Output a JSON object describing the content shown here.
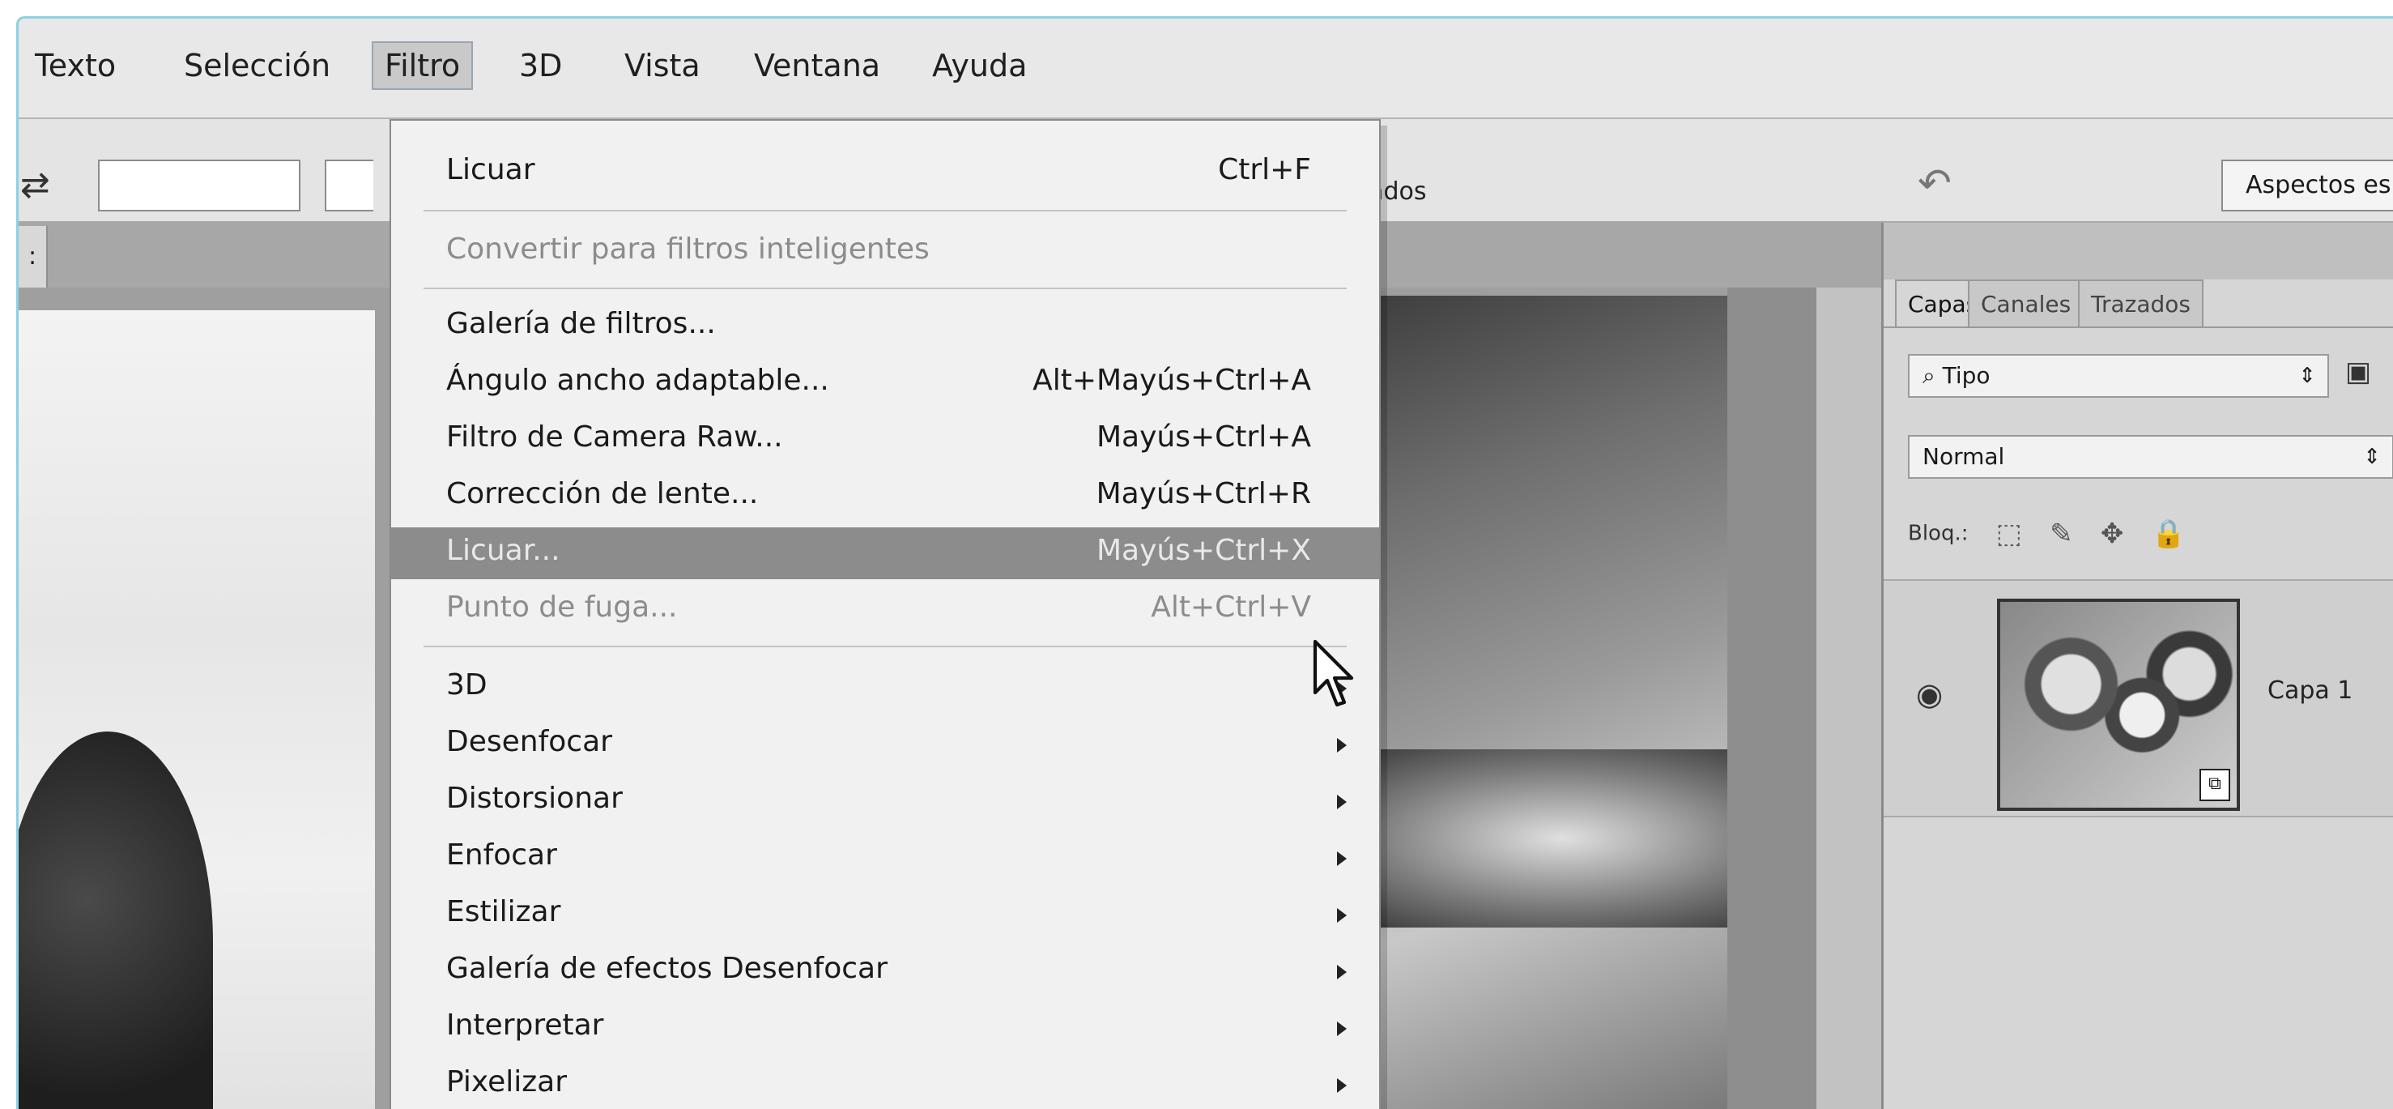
{
  "menubar": {
    "items": [
      {
        "label": "Texto"
      },
      {
        "label": "Selección"
      },
      {
        "label": "Filtro"
      },
      {
        "label": "3D"
      },
      {
        "label": "Vista"
      },
      {
        "label": "Ventana"
      },
      {
        "label": "Ayuda"
      }
    ],
    "active": "Filtro"
  },
  "options_bar": {
    "fragment_label": "recortados",
    "workspace_label": "Aspectos es",
    "icons": [
      "swap-arrows-icon",
      "undo-icon"
    ]
  },
  "document_tab": {
    "label": ":"
  },
  "filter_menu": {
    "last_filter": {
      "label": "Licuar",
      "shortcut": "Ctrl+F"
    },
    "convert_smart": {
      "label": "Convertir para filtros inteligentes"
    },
    "gallery": {
      "label": "Galería de filtros..."
    },
    "wide_angle": {
      "label": "Ángulo ancho adaptable...",
      "shortcut": "Alt+Mayús+Ctrl+A"
    },
    "camera_raw": {
      "label": "Filtro de Camera Raw...",
      "shortcut": "Mayús+Ctrl+A"
    },
    "lens": {
      "label": "Corrección de lente...",
      "shortcut": "Mayús+Ctrl+R"
    },
    "liquify": {
      "label": "Licuar...",
      "shortcut": "Mayús+Ctrl+X"
    },
    "vanishing": {
      "label": "Punto de fuga...",
      "shortcut": "Alt+Ctrl+V"
    },
    "submenus": [
      {
        "label": "3D"
      },
      {
        "label": "Desenfocar"
      },
      {
        "label": "Distorsionar"
      },
      {
        "label": "Enfocar"
      },
      {
        "label": "Estilizar"
      },
      {
        "label": "Galería de efectos Desenfocar"
      },
      {
        "label": "Interpretar"
      },
      {
        "label": "Pixelizar"
      }
    ]
  },
  "layers_panel": {
    "tabs": [
      {
        "label": "Capas"
      },
      {
        "label": "Canales"
      },
      {
        "label": "Trazados"
      }
    ],
    "active_tab": "Capas",
    "filter_kind": "Tipo",
    "blend_mode": "Normal",
    "lock_label": "Bloq.:",
    "lock_icons": [
      "lock-transparent-icon",
      "lock-paint-icon",
      "lock-position-icon",
      "lock-all-icon"
    ],
    "layer": {
      "name": "Capa 1",
      "visible": true
    }
  },
  "colors": {
    "menu_highlight": "#8c8c8c",
    "window_border": "#8ed0e4",
    "disabled_text": "#8c8c8c"
  }
}
